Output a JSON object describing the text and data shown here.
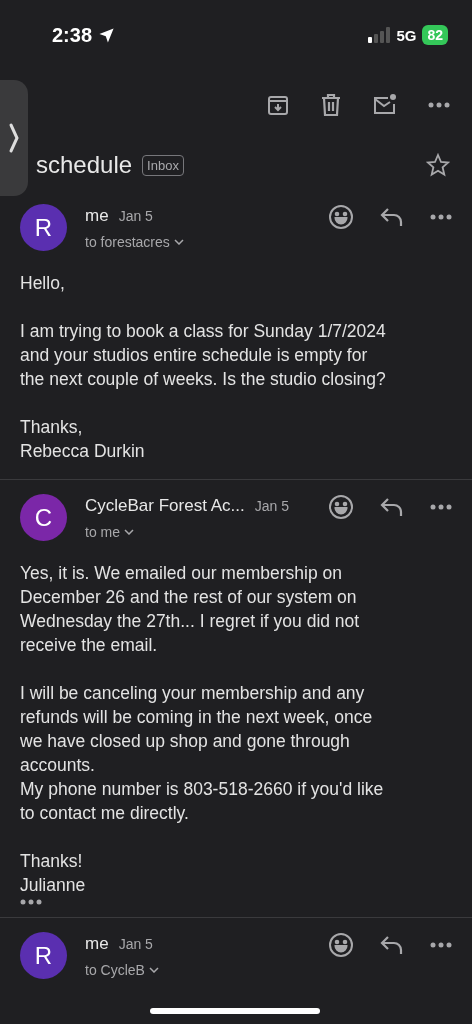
{
  "status_bar": {
    "time": "2:38",
    "network": "5G",
    "battery": "82"
  },
  "subject": {
    "title": "schedule",
    "label": "Inbox",
    "starred": false
  },
  "messages": [
    {
      "avatar": "R",
      "color": "#5a2fb0",
      "sender": "me",
      "date": "Jan 5",
      "recipient": "to forestacres",
      "paragraphs": [
        [
          "Hello,"
        ],
        [
          "I am trying to book a class for Sunday 1/7/2024",
          "and your studios entire schedule is empty for",
          "the next couple of weeks. Is the studio closing?"
        ],
        [
          "Thanks,",
          "Rebecca Durkin"
        ]
      ],
      "collapsed_quote": false
    },
    {
      "avatar": "C",
      "color": "#7b27a8",
      "sender": "CycleBar Forest Ac...",
      "date": "Jan 5",
      "recipient": "to me",
      "paragraphs": [
        [
          "Yes, it is. We emailed our membership on",
          "December 26 and the rest of our system on",
          "Wednesday the 27th... I regret if you did not",
          "receive the email."
        ],
        [
          "I will be canceling your membership and any",
          "refunds will be coming in the next week, once",
          "we have closed up shop and gone through",
          "accounts.",
          "My phone number is 803-518-2660 if you'd like",
          "to contact me directly."
        ],
        [
          "Thanks!",
          "Julianne"
        ]
      ],
      "collapsed_quote": true
    },
    {
      "avatar": "R",
      "color": "#5a2fb0",
      "sender": "me",
      "date": "Jan 5",
      "recipient": "to CycleB",
      "collapsed_quote": false
    }
  ]
}
